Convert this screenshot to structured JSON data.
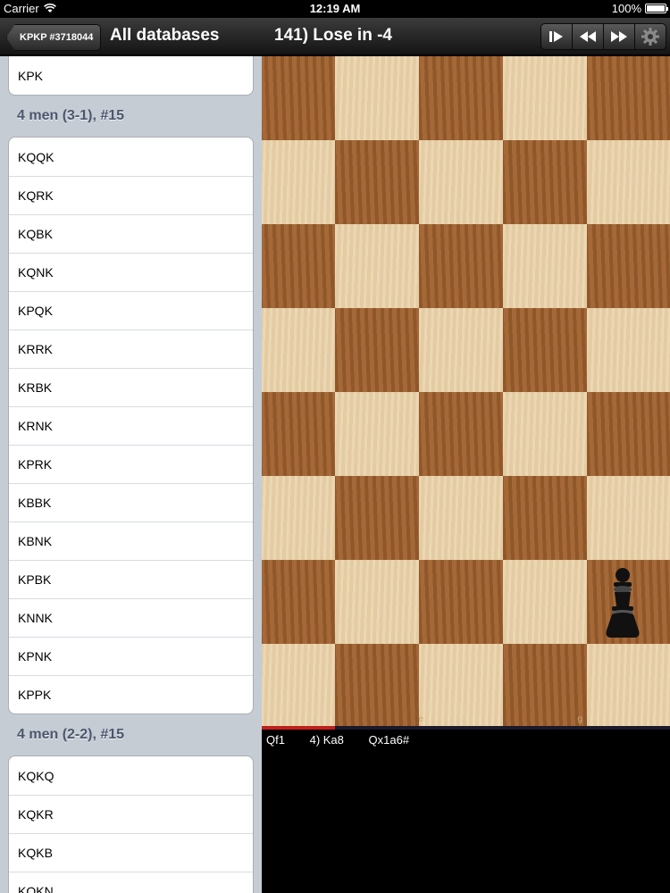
{
  "status_bar": {
    "carrier": "Carrier",
    "time": "12:19 AM",
    "battery": "100%"
  },
  "left_nav": {
    "back_label": "KPKP #3718044",
    "title": "All databases"
  },
  "right_nav": {
    "title": "141) Lose in -4",
    "toolbar": {
      "step_icon": "step-forward-icon",
      "rewind_icon": "rewind-icon",
      "fast_forward_icon": "fast-forward-icon",
      "settings_icon": "gear-icon"
    }
  },
  "list": {
    "top_items": [
      "KPK"
    ],
    "sections": [
      {
        "header": "4 men (3-1), #15",
        "items": [
          "KQQK",
          "KQRK",
          "KQBK",
          "KQNK",
          "KPQK",
          "KRRK",
          "KRBK",
          "KRNK",
          "KPRK",
          "KBBK",
          "KBNK",
          "KPBK",
          "KNNK",
          "KPNK",
          "KPPK"
        ]
      },
      {
        "header": "4 men (2-2), #15",
        "items": [
          "KQKQ",
          "KQKR",
          "KQKB",
          "KQKN"
        ]
      }
    ]
  },
  "board": {
    "colors": {
      "light": "#ead2a8",
      "dark": "#a0612e"
    },
    "file_labels": [
      "e",
      "g"
    ],
    "pieces": [
      {
        "type": "pawn",
        "color": "black",
        "icon": "black-pawn-icon"
      }
    ]
  },
  "moves": {
    "items": [
      "Qf1",
      "4)  Ka8",
      "Qx1a6#"
    ]
  }
}
